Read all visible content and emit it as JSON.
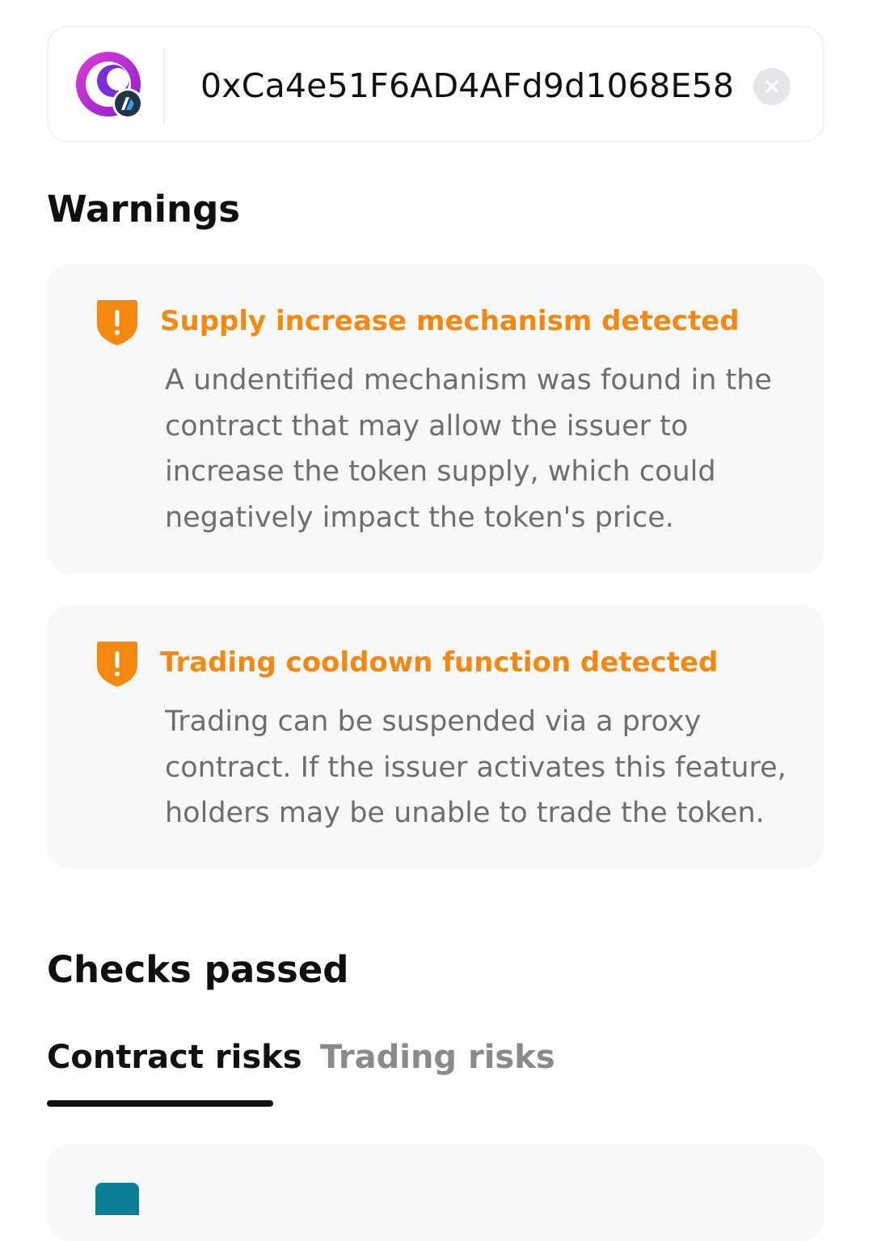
{
  "address_box": {
    "address": "0xCa4e51F6AD4AFd9d1068E58"
  },
  "warnings": {
    "title": "Warnings",
    "items": [
      {
        "title": "Supply increase mechanism detected",
        "body": "A undentified mechanism was found in the contract that may allow the issuer to increase the token supply, which could negatively impact the token's price."
      },
      {
        "title": "Trading cooldown function detected",
        "body": "Trading can be suspended via a proxy contract. If the issuer activates this feature, holders may be unable to trade the token."
      }
    ]
  },
  "checks": {
    "title": "Checks passed",
    "tabs": [
      {
        "label": "Contract risks",
        "active": true
      },
      {
        "label": "Trading risks",
        "active": false
      }
    ]
  },
  "colors": {
    "warning": "#f5880f",
    "active_tab": "#111111",
    "inactive_tab": "#8a8a8a",
    "card_background": "#f6f8fa",
    "check_icon": "#0b7f96"
  },
  "icons": {
    "token_logo": "token-logo-icon",
    "clear": "close-icon",
    "warning": "shield-warning-icon",
    "check": "shield-check-icon"
  }
}
